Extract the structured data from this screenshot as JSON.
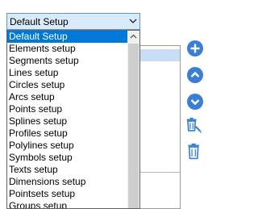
{
  "combo": {
    "value": "Default Setup",
    "options": [
      "Default Setup",
      "Elements setup",
      "Segments setup",
      "Lines setup",
      "Circles setup",
      "Arcs setup",
      "Points setup",
      "Splines setup",
      "Profiles setup",
      "Polylines setup",
      "Symbols setup",
      "Texts setup",
      "Dimensions setup",
      "Pointsets setup",
      "Groups setup"
    ]
  },
  "toolbar": {
    "add_icon": "plus-circle-icon",
    "move_up_icon": "chevron-up-circle-icon",
    "move_down_icon": "chevron-down-circle-icon",
    "delete_edit_icon": "trash-edit-icon",
    "delete_icon": "trash-icon"
  },
  "colors": {
    "accent": "#0078d7",
    "button_blue": "#3a7fd5"
  }
}
